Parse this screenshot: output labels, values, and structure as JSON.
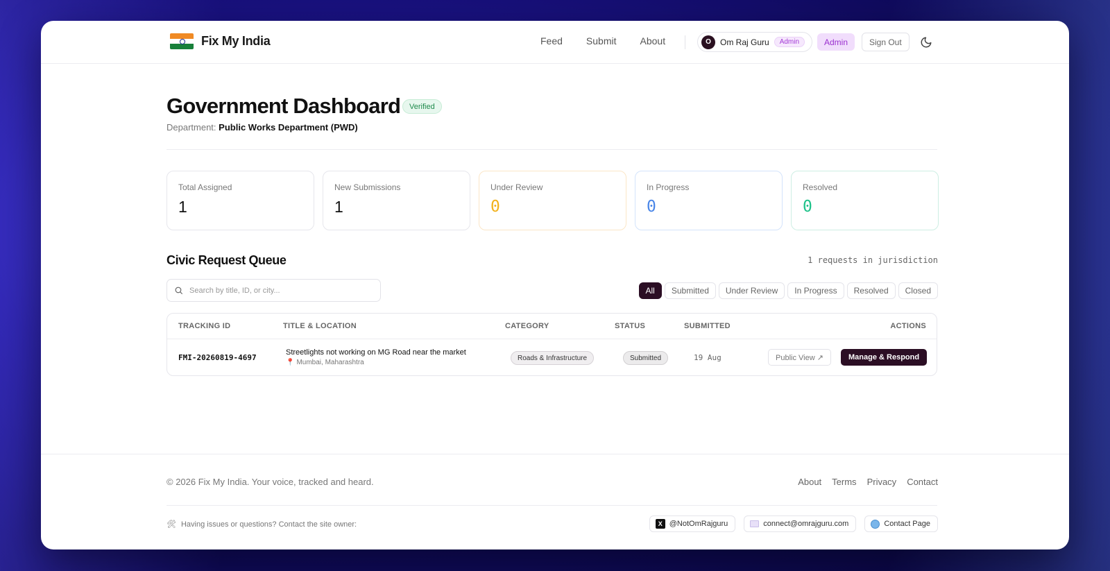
{
  "brand": {
    "name": "Fix My India"
  },
  "nav": {
    "feed": "Feed",
    "submit": "Submit",
    "about": "About"
  },
  "user": {
    "initial": "O",
    "name": "Om Raj Guru",
    "role": "Admin"
  },
  "header": {
    "admin_label": "Admin",
    "signout_label": "Sign Out"
  },
  "page": {
    "title": "Government Dashboard",
    "verified": "Verified",
    "dept_label": "Department:",
    "dept_value": "Public Works Department (PWD)"
  },
  "stats": [
    {
      "label": "Total Assigned",
      "value": "1"
    },
    {
      "label": "New Submissions",
      "value": "1"
    },
    {
      "label": "Under Review",
      "value": "0"
    },
    {
      "label": "In Progress",
      "value": "0"
    },
    {
      "label": "Resolved",
      "value": "0"
    }
  ],
  "queue": {
    "title": "Civic Request Queue",
    "count_text": "1 requests in jurisdiction",
    "search_placeholder": "Search by title, ID, or city...",
    "filters": [
      "All",
      "Submitted",
      "Under Review",
      "In Progress",
      "Resolved",
      "Closed"
    ],
    "active_filter": "All"
  },
  "table": {
    "headers": {
      "id": "TRACKING ID",
      "title": "TITLE & LOCATION",
      "category": "CATEGORY",
      "status": "STATUS",
      "submitted": "SUBMITTED",
      "actions": "ACTIONS"
    },
    "rows": [
      {
        "id": "FMI-20260819-4697",
        "title": "Streetlights not working on MG Road near the market",
        "location": "Mumbai, Maharashtra",
        "category": "Roads & Infrastructure",
        "status": "Submitted",
        "submitted": "19 Aug",
        "public_view": "Public View ↗",
        "manage": "Manage & Respond"
      }
    ]
  },
  "footer": {
    "copyright": "© 2026 Fix My India. Your voice, tracked and heard.",
    "links": {
      "about": "About",
      "terms": "Terms",
      "privacy": "Privacy",
      "contact": "Contact"
    },
    "help_text": "Having issues or questions? Contact the site owner:",
    "twitter": "@NotOmRajguru",
    "email": "connect@omrajguru.com",
    "contact_page": "Contact Page"
  },
  "colors": {
    "accent": "#2b0e24",
    "admin": "#9a2fcf",
    "verified": "#1f8a4c",
    "review": "#f2b21c",
    "progress": "#4a86e8",
    "resolved": "#1fc28a"
  }
}
